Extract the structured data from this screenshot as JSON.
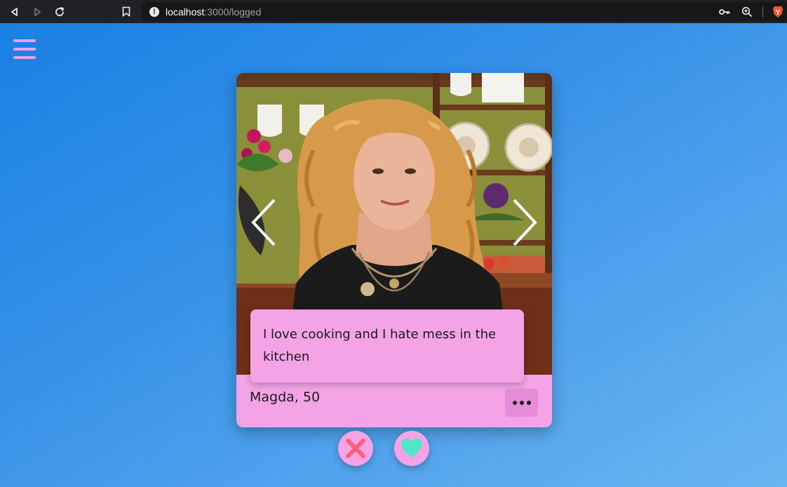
{
  "browser": {
    "url_host": "localhost",
    "url_path": ":3000/logged"
  },
  "icons": {
    "back": "back-icon",
    "forward": "forward-icon",
    "reload": "reload-icon",
    "bookmark": "bookmark-icon",
    "site_info": "info-icon",
    "key": "key-icon",
    "zoom": "zoom-icon",
    "brave": "brave-icon",
    "menu": "hamburger-icon",
    "prev_photo": "chevron-left-icon",
    "next_photo": "chevron-right-icon",
    "more": "more-icon",
    "reject": "close-icon",
    "like": "heart-icon"
  },
  "profile": {
    "bio": "I love cooking and I hate mess in the kitchen",
    "name_age": "Magda, 50"
  },
  "colors": {
    "accent_pink": "#f4a3e6",
    "more_button": "#e48cd8",
    "reject": "#fe5f7a",
    "like": "#4de6c6",
    "menu": "#f0a0e6"
  }
}
